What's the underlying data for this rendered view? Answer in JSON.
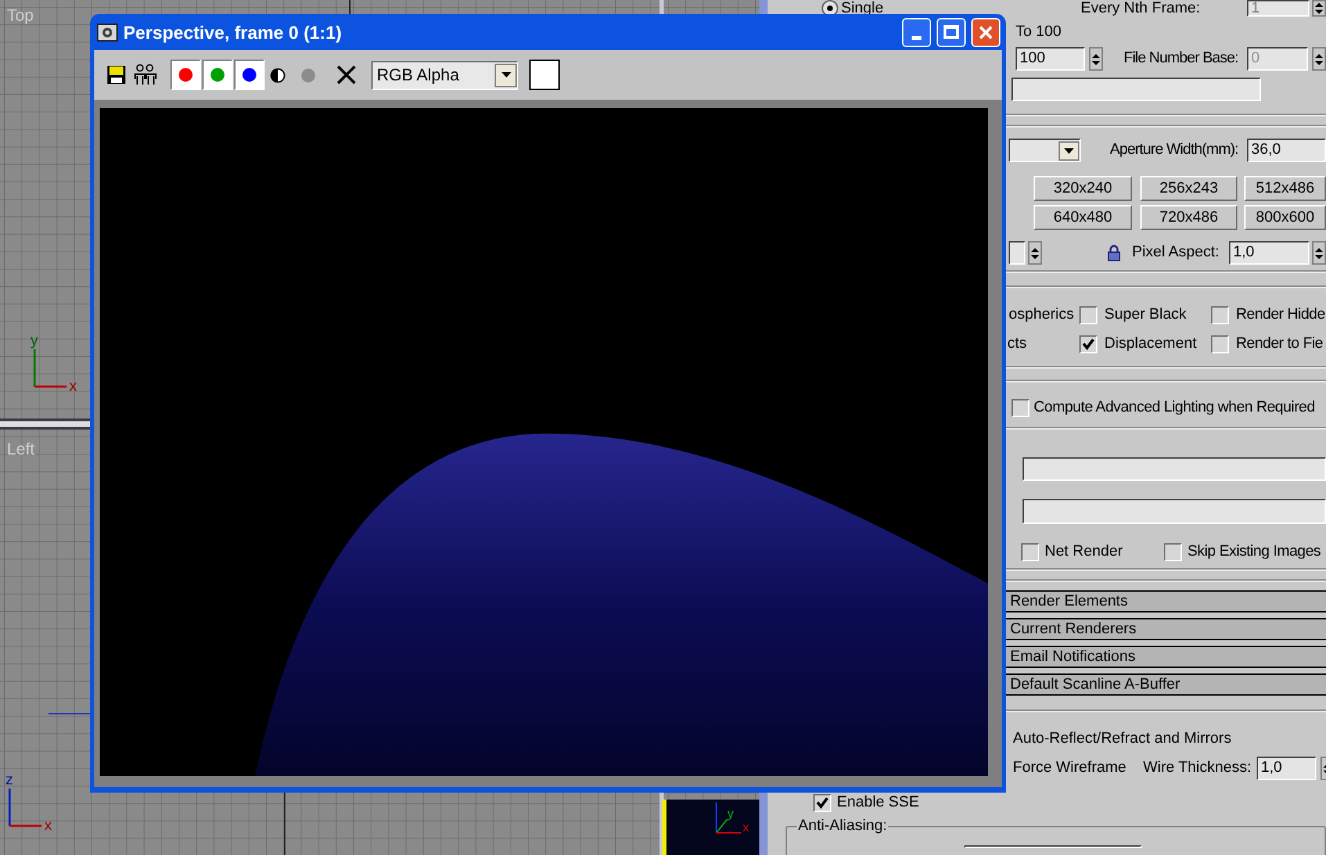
{
  "viewports": [
    {
      "label": "Top",
      "axes": [
        "y",
        "x"
      ]
    },
    {
      "label": "Left",
      "axes": [
        "z",
        "x"
      ]
    }
  ],
  "perspective_viewport": {
    "active": true,
    "axes": [
      "y",
      "x"
    ]
  },
  "render_window": {
    "title": "Perspective, frame 0 (1:1)",
    "channel_mode": "RGB Alpha",
    "channels": [
      {
        "color": "#ff0000",
        "selected": true
      },
      {
        "color": "#00a000",
        "selected": true
      },
      {
        "color": "#0000ff",
        "selected": true
      }
    ]
  },
  "render_setup": {
    "single": {
      "label": "Single",
      "selected": true
    },
    "every_nth_label": "Every Nth Frame:",
    "every_nth_value": "1",
    "range_to": "To 100",
    "range_end": "100",
    "file_base_label": "File Number Base:",
    "file_base_value": "0",
    "aperture_label": "Aperture Width(mm):",
    "aperture_value": "36,0",
    "presets": [
      "320x240",
      "256x243",
      "512x486",
      "640x480",
      "720x486",
      "800x600"
    ],
    "pixel_aspect_label": "Pixel Aspect:",
    "pixel_aspect_value": "1,0",
    "cut_labels": [
      "ospherics",
      "cts"
    ],
    "options": [
      {
        "label": "Super Black",
        "checked": false
      },
      {
        "label": "Render Hidde",
        "checked": false
      },
      {
        "label": "Displacement",
        "checked": true
      },
      {
        "label": "Render to Fie",
        "checked": false
      }
    ],
    "advanced_lighting": {
      "label": "Compute Advanced Lighting when Required",
      "checked": false
    },
    "net_render": {
      "label": "Net Render",
      "checked": false
    },
    "skip_existing": {
      "label": "Skip Existing Images",
      "checked": false
    },
    "rollouts": [
      "Render Elements",
      "Current Renderers",
      "Email Notifications",
      "Default Scanline A-Buffer"
    ],
    "auto_reflect": "Auto-Reflect/Refract and Mirrors",
    "force_wireframe": "Force Wireframe",
    "wire_thickness_label": "Wire Thickness:",
    "wire_thickness_value": "1,0",
    "enable_sse": {
      "label": "Enable SSE",
      "checked": true
    },
    "anti_aliasing_label": "Anti-Aliasing:"
  }
}
